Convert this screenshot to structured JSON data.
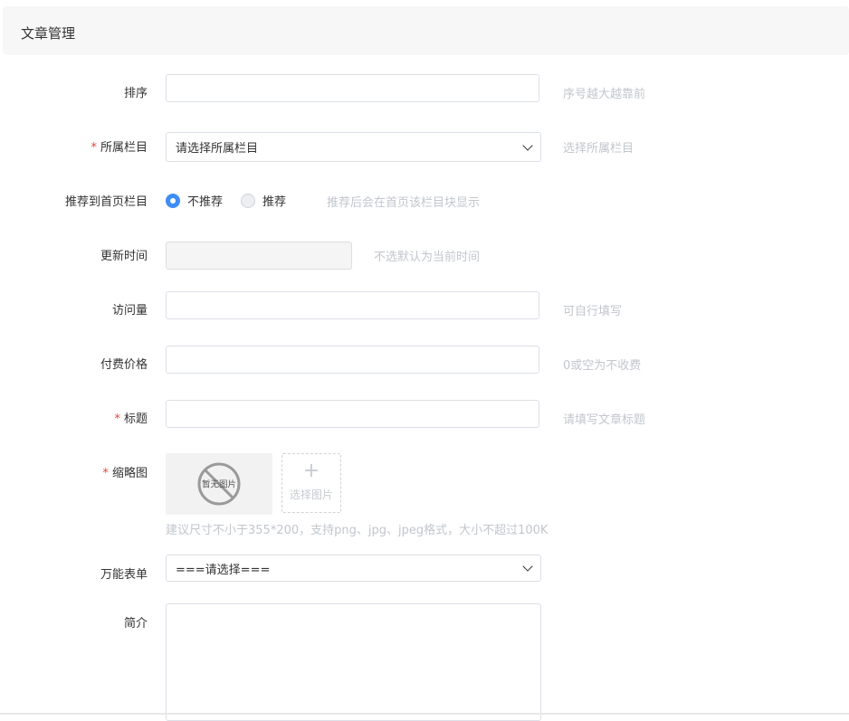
{
  "header": {
    "title": "文章管理"
  },
  "form": {
    "sort": {
      "label": "排序",
      "value": "",
      "hint": "序号越大越靠前"
    },
    "category": {
      "required_mark": "*",
      "label": "所属栏目",
      "selected": "请选择所属栏目",
      "hint": "选择所属栏目"
    },
    "recommend": {
      "label": "推荐到首页栏目",
      "options": [
        {
          "label": "不推荐",
          "checked": true
        },
        {
          "label": "推荐",
          "checked": false
        }
      ],
      "hint": "推荐后会在首页该栏目块显示"
    },
    "update_time": {
      "label": "更新时间",
      "value": "",
      "hint": "不选默认为当前时间"
    },
    "views": {
      "label": "访问量",
      "value": "",
      "hint": "可自行填写"
    },
    "price": {
      "label": "付费价格",
      "value": "",
      "hint": "0或空为不收费"
    },
    "title": {
      "required_mark": "*",
      "label": "标题",
      "value": "",
      "hint": "请填写文章标题"
    },
    "thumbnail": {
      "required_mark": "*",
      "label": "缩略图",
      "empty_text": "暂无图片",
      "picker_plus": "+",
      "picker_label": "选择图片",
      "hint": "建议尺寸不小于355*200，支持png、jpg、jpeg格式，大小不超过100K"
    },
    "universal_form": {
      "label": "万能表单",
      "selected": "===请选择==="
    },
    "intro": {
      "label": "简介",
      "value": ""
    }
  },
  "colors": {
    "accent": "#3e8ef7",
    "required": "#e2463e",
    "hint": "#c2c6cc",
    "header_bg": "#f7f7f7"
  },
  "icons": {
    "select_caret": "chevron-down-icon",
    "no_image": "no-image-icon"
  }
}
